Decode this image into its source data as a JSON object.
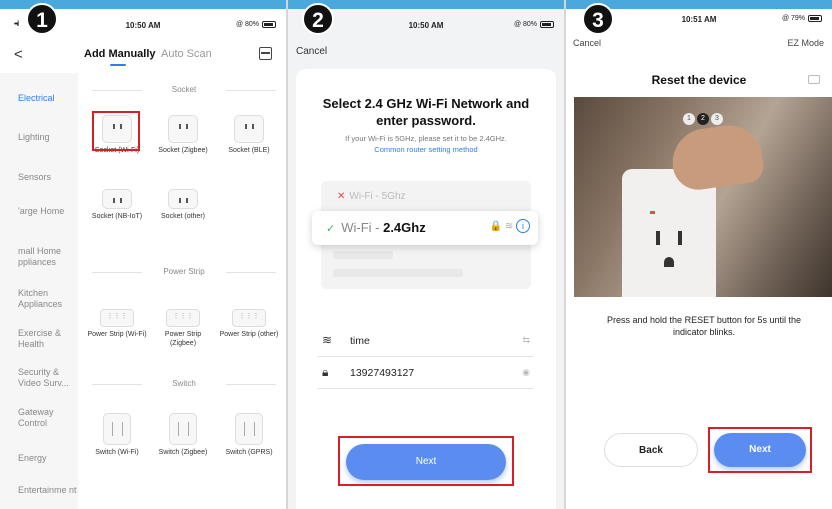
{
  "steps": [
    "1",
    "2",
    "3"
  ],
  "panel1": {
    "status": {
      "left": "••il",
      "time": "10:50 AM",
      "right": "@ 80%"
    },
    "tabs": {
      "back": "<",
      "add_manually": "Add Manually",
      "auto_scan": "Auto Scan"
    },
    "sidebar": [
      {
        "label": "Electrical",
        "active": true
      },
      {
        "label": "Lighting"
      },
      {
        "label": "Sensors"
      },
      {
        "label": "'arge Home"
      },
      {
        "label": "mall Home ppliances"
      },
      {
        "label": "Kitchen Appliances"
      },
      {
        "label": "Exercise & Health"
      },
      {
        "label": "Security & Video Surv..."
      },
      {
        "label": "Gateway Control"
      },
      {
        "label": "Energy"
      },
      {
        "label": "Entertainme nt"
      }
    ],
    "sections": {
      "socket": "Socket",
      "power_strip": "Power Strip",
      "switch": "Switch"
    },
    "devices": {
      "socket_wifi": "Socket (Wi-Fi)",
      "socket_zigbee": "Socket (Zigbee)",
      "socket_ble": "Socket (BLE)",
      "socket_nbiot": "Socket (NB-IoT)",
      "socket_other": "Socket (other)",
      "strip_wifi": "Power Strip (Wi-Fi)",
      "strip_zigbee": "Power Strip (Zigbee)",
      "strip_other": "Power Strip (other)",
      "switch_wifi": "Switch (Wi-Fi)",
      "switch_zigbee": "Switch (Zigbee)",
      "switch_gprs": "Switch (GPRS)"
    }
  },
  "panel2": {
    "status": {
      "time": "10:50 AM",
      "right": "@ 80%"
    },
    "cancel": "Cancel",
    "title": "Select 2.4 GHz Wi-Fi Network and enter password.",
    "subtitle": "If your Wi-Fi is 5GHz, please set it to be 2.4GHz.",
    "link": "Common router setting method",
    "wifi_5": {
      "prefix": "Wi-Fi - ",
      "band": "5Ghz"
    },
    "wifi_24": {
      "prefix": "Wi-Fi - ",
      "band": "2.4Ghz"
    },
    "ssid": "time",
    "password": "13927493127",
    "next": "Next"
  },
  "panel3": {
    "status": {
      "time": "10:51 AM",
      "right": "@ 79%"
    },
    "cancel": "Cancel",
    "mode": "EZ Mode",
    "title": "Reset the device",
    "dots": [
      "1",
      "2",
      "3"
    ],
    "instruction": "Press and hold the RESET button for 5s until the indicator blinks.",
    "back": "Back",
    "next": "Next"
  },
  "colors": {
    "accent": "#5b8df0",
    "highlight": "#d91f26",
    "check": "#3ab56b",
    "error": "#e5474d"
  }
}
